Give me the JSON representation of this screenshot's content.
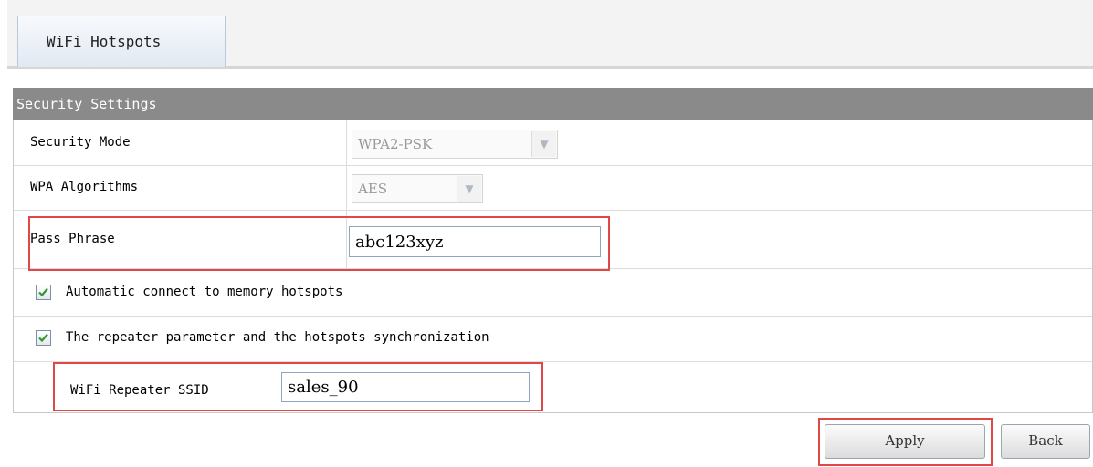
{
  "tabs": [
    {
      "label": "WiFi Hotspots"
    }
  ],
  "section": {
    "title": "Security Settings"
  },
  "form": {
    "security_mode": {
      "label": "Security Mode",
      "value": "WPA2-PSK"
    },
    "wpa_algorithms": {
      "label": "WPA Algorithms",
      "value": "AES"
    },
    "pass_phrase": {
      "label": "Pass Phrase",
      "value": "abc123xyz"
    },
    "auto_connect": {
      "label": "Automatic connect to memory hotspots",
      "checked": true
    },
    "repeater_sync": {
      "label": "The repeater parameter and the hotspots synchronization",
      "checked": true
    },
    "repeater_ssid": {
      "label": "WiFi Repeater SSID",
      "value": "sales_90"
    }
  },
  "buttons": {
    "apply": "Apply",
    "back": "Back"
  },
  "colors": {
    "section_header_bg": "#8a8a8a",
    "highlight_border": "#e04848",
    "checkbox_check": "#2f9a2f"
  },
  "icons": {
    "dropdown": "chevron-down-icon",
    "checkmark": "check-icon"
  }
}
